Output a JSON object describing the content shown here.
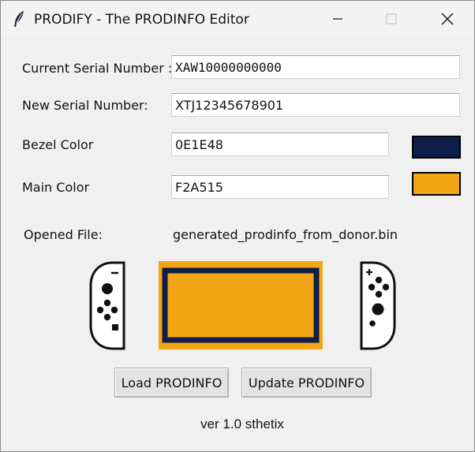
{
  "window": {
    "title": "PRODIFY - The PRODINFO Editor",
    "controls": {
      "minimize_icon": "minimize-icon",
      "maximize_icon": "maximize-icon",
      "close_icon": "close-icon"
    }
  },
  "form": {
    "current_serial": {
      "label": "Current Serial Number :",
      "value": "XAW10000000000"
    },
    "new_serial": {
      "label": "New Serial Number:",
      "value": "XTJ12345678901"
    },
    "bezel_color": {
      "label": "Bezel Color",
      "value": "0E1E48",
      "swatch": "#0E1E48"
    },
    "main_color": {
      "label": "Main Color",
      "value": "F2A515",
      "swatch": "#F2A515"
    }
  },
  "file": {
    "label": "Opened File:",
    "name": "generated_prodinfo_from_donor.bin"
  },
  "preview": {
    "left_joycon_icon": "left-joycon-icon",
    "console_icon": "switch-console-icon",
    "right_joycon_icon": "right-joycon-icon"
  },
  "buttons": {
    "load": "Load PRODINFO",
    "update": "Update PRODINFO"
  },
  "footer": {
    "version": "ver 1.0 sthetix"
  }
}
